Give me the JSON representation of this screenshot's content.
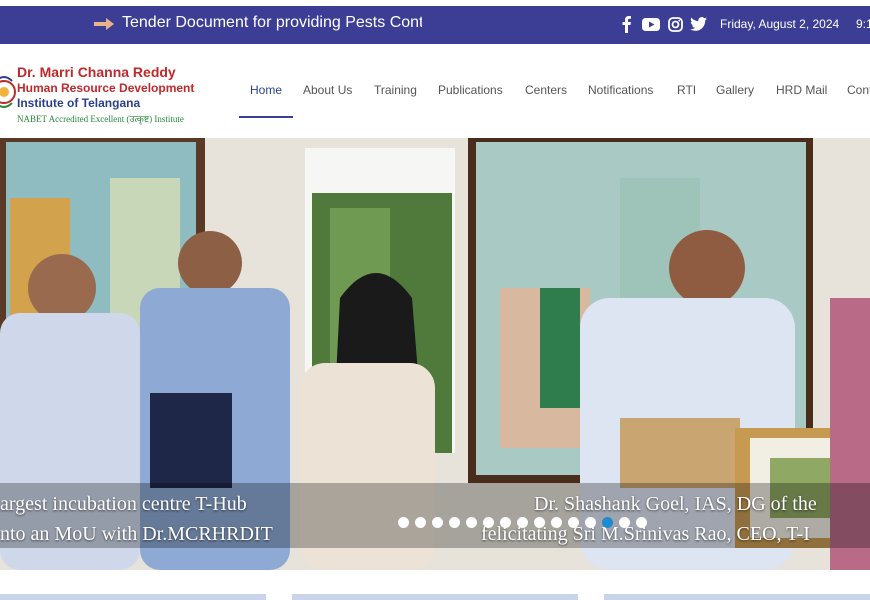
{
  "ticker": {
    "text": "Tender Document for providing Pests Control :"
  },
  "topbar": {
    "date": "Friday, August 2, 2024",
    "time": "9:1",
    "social": [
      "facebook-icon",
      "youtube-icon",
      "instagram-icon",
      "twitter-icon"
    ]
  },
  "logo": {
    "line1": "Dr. Marri Channa Reddy",
    "line2": "Human Resource Development",
    "line3": "Institute of Telangana",
    "line4": "NABET Accredited Excellent (उत्कृष्ट) Institute"
  },
  "nav": {
    "items": [
      "Home",
      "About Us",
      "Training",
      "Publications",
      "Centers",
      "Notifications",
      "RTI",
      "Gallery",
      "HRD Mail",
      "Cont"
    ],
    "active": "Home"
  },
  "slider": {
    "caption_left_1": "argest incubation centre T-Hub",
    "caption_left_2": "nto an MoU with Dr.MCRHRDIT",
    "caption_right_1": "Dr. Shashank Goel, IAS, DG of the",
    "caption_right_2": "felicitating Sri M.Srinivas Rao, CEO, T-I",
    "dot_count": 15,
    "active_dot": 12
  },
  "colors": {
    "topbar": "#3c3e96",
    "accent": "#2b3f8f",
    "logo_red": "#c0282c",
    "nabet_green": "#2a8a3a",
    "active_dot": "#1f8bd0"
  }
}
